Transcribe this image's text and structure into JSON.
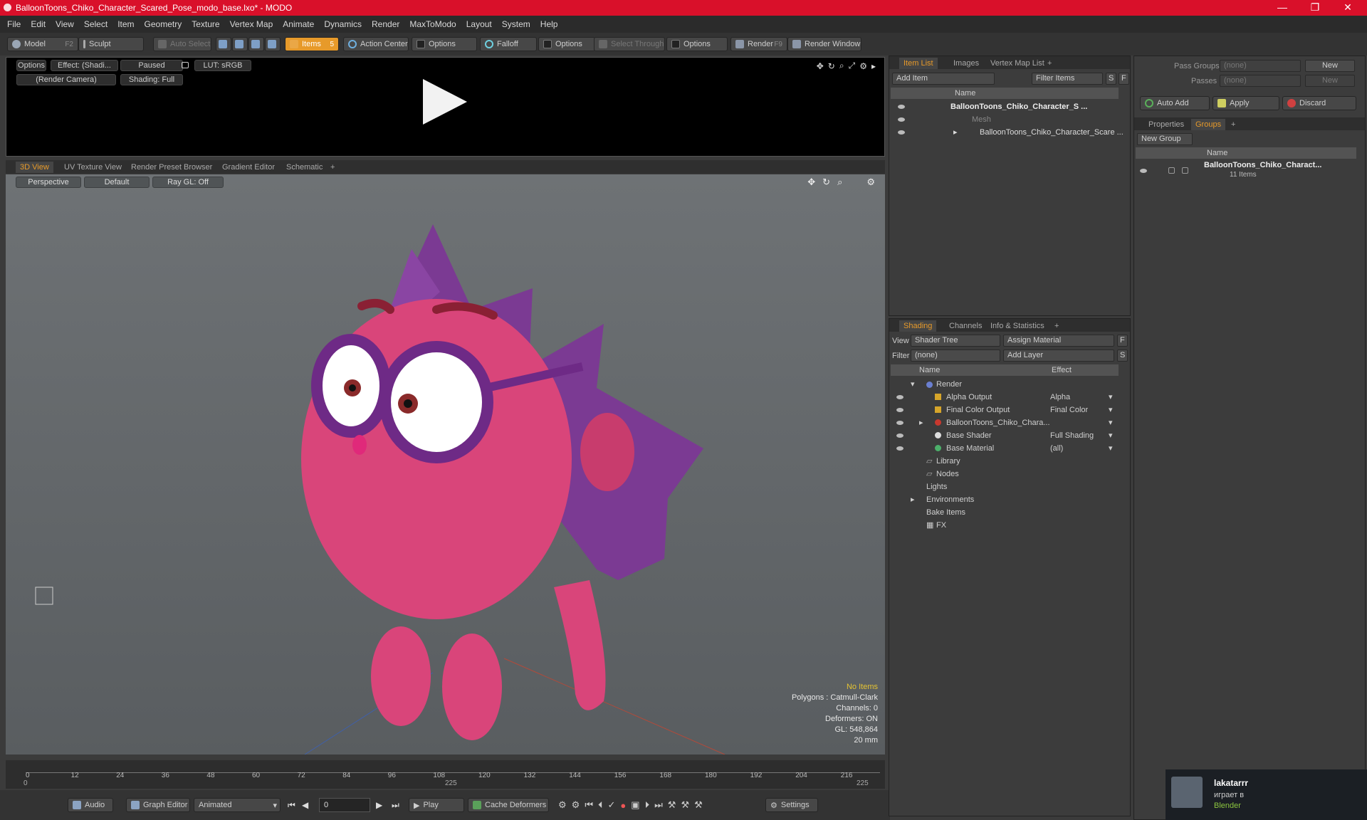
{
  "window": {
    "title": "BalloonToons_Chiko_Character_Scared_Pose_modo_base.lxo* - MODO",
    "minimize": "—",
    "maximize": "❐",
    "close": "✕"
  },
  "menu": [
    "File",
    "Edit",
    "View",
    "Select",
    "Item",
    "Geometry",
    "Texture",
    "Vertex Map",
    "Animate",
    "Dynamics",
    "Render",
    "MaxToModo",
    "Layout",
    "System",
    "Help"
  ],
  "toolbar": {
    "model": "Model",
    "model_key": "F2",
    "sculpt": "Sculpt",
    "auto_select": "Auto Select",
    "items": "Items",
    "items_key": "5",
    "action_center": "Action Center",
    "options1": "Options",
    "falloff": "Falloff",
    "options2": "Options",
    "select_through": "Select Through",
    "options3": "Options",
    "render": "Render",
    "render_key": "F9",
    "render_window": "Render Window"
  },
  "preview": {
    "options": "Options",
    "effect": "Effect: (Shadi...",
    "paused": "Paused",
    "lut": "LUT: sRGB",
    "camera": "(Render Camera)",
    "shading": "Shading: Full"
  },
  "view_tabs": [
    "3D View",
    "UV Texture View",
    "Render Preset Browser",
    "Gradient Editor",
    "Schematic"
  ],
  "viewport": {
    "perspective": "Perspective",
    "default": "Default",
    "raygl": "Ray GL: Off",
    "stats": {
      "no_items": "No Items",
      "polygons": "Polygons : Catmull-Clark",
      "channels": "Channels: 0",
      "deformers": "Deformers: ON",
      "gl": "GL: 548,864",
      "scale": "20 mm"
    }
  },
  "timeline": {
    "ticks": [
      "0",
      "12",
      "24",
      "36",
      "48",
      "60",
      "72",
      "84",
      "96",
      "108",
      "120",
      "132",
      "144",
      "156",
      "168",
      "180",
      "192",
      "204",
      "216"
    ],
    "start": "0",
    "mid": "225",
    "end": "225"
  },
  "bottombar": {
    "audio": "Audio",
    "graph_editor": "Graph Editor",
    "animated": "Animated",
    "frame": "0",
    "play": "Play",
    "cache_deformers": "Cache Deformers",
    "settings": "Settings"
  },
  "item_list": {
    "tabs": [
      "Item List",
      "Images",
      "Vertex Map List"
    ],
    "add_item": "Add Item",
    "filter": "Filter Items",
    "s": "S",
    "f": "F",
    "col_name": "Name",
    "rows": [
      "BalloonToons_Chiko_Character_S ...",
      "Mesh",
      "BalloonToons_Chiko_Character_Scare ..."
    ]
  },
  "shading": {
    "tabs": [
      "Shading",
      "Channels",
      "Info & Statistics"
    ],
    "view_label": "View",
    "view_value": "Shader Tree",
    "assign": "Assign Material",
    "filter_label": "Filter",
    "filter_value": "(none)",
    "add_layer": "Add Layer",
    "f": "F",
    "s": "S",
    "col_name": "Name",
    "col_effect": "Effect",
    "rows": [
      {
        "name": "Render",
        "effect": ""
      },
      {
        "name": "Alpha Output",
        "effect": "Alpha"
      },
      {
        "name": "Final Color Output",
        "effect": "Final Color"
      },
      {
        "name": "BalloonToons_Chiko_Chara...",
        "effect": ""
      },
      {
        "name": "Base Shader",
        "effect": "Full Shading"
      },
      {
        "name": "Base Material",
        "effect": "(all)"
      },
      {
        "name": "Library",
        "effect": ""
      },
      {
        "name": "Nodes",
        "effect": ""
      },
      {
        "name": "Lights",
        "effect": ""
      },
      {
        "name": "Environments",
        "effect": ""
      },
      {
        "name": "Bake Items",
        "effect": ""
      },
      {
        "name": "FX",
        "effect": ""
      }
    ]
  },
  "groups": {
    "pass_groups": "Pass Groups",
    "pass_value": "(none)",
    "passes": "Passes",
    "passes_value": "(none)",
    "new": "New",
    "new2": "New",
    "auto_add": "Auto Add",
    "apply": "Apply",
    "discard": "Discard",
    "tabs": [
      "Properties",
      "Groups"
    ],
    "new_group": "New Group",
    "col_name": "Name",
    "group_name": "BalloonToons_Chiko_Charact...",
    "group_count": "11 Items"
  },
  "notification": {
    "user": "lakatarrr",
    "status": "играет в",
    "game": "Blender"
  },
  "colors": {
    "accent": "#e79a2a",
    "title": "#d9102a",
    "char_body": "#d9457a",
    "char_spikes": "#7b3a93"
  }
}
